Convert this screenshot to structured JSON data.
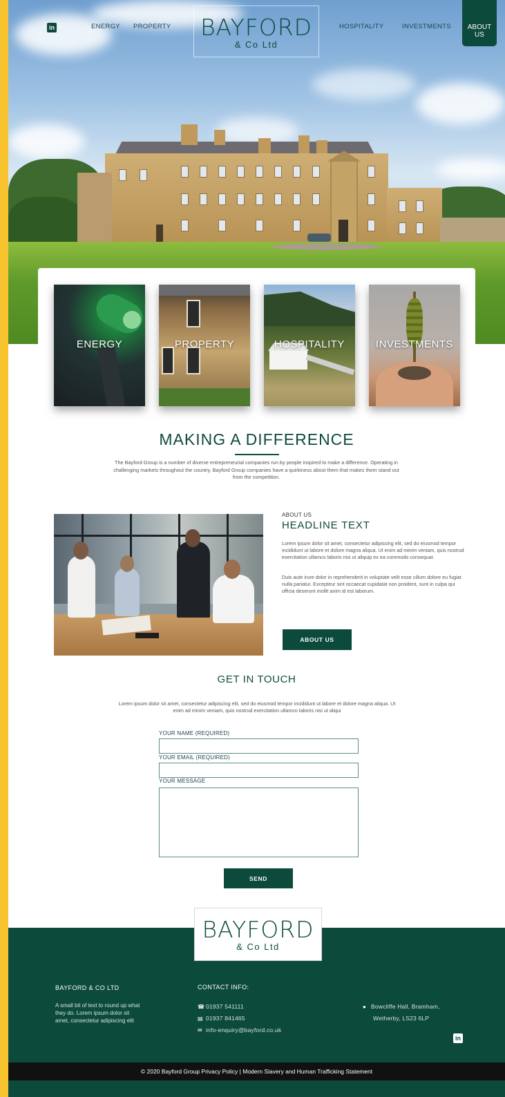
{
  "nav": {
    "linkedin_icon": "linkedin-icon",
    "left_links": [
      "ENERGY",
      "PROPERTY"
    ],
    "right_links": [
      "HOSPITALITY",
      "INVESTMENTS"
    ],
    "about_line1": "ABOUT",
    "about_line2": "US"
  },
  "logo": {
    "main": "BAYFORD",
    "sub": "& Co Ltd"
  },
  "cards": [
    {
      "label": "ENERGY"
    },
    {
      "label": "PROPERTY"
    },
    {
      "label": "HOSPITALITY"
    },
    {
      "label": "INVESTMENTS"
    }
  ],
  "intro": {
    "heading": "MAKING A DIFFERENCE",
    "text": "The Bayford Group is a number of diverse entrepreneurial companies run by people inspired to make a difference. Operating in challenging markets throughout the country, Bayford Group companies have a quirkiness about them that makes them stand out from the competition."
  },
  "about": {
    "eyebrow": "ABOUT US",
    "heading": "HEADLINE TEXT",
    "p1": "Lorem ipsum dolor sit amet, consectetur adipiscing elit, sed do eiusmod tempor incididunt ut labore et dolore magna aliqua. Ut enim ad minim veniam, quis nostrud exercitation ullamco laboris nisi ut aliquip ex ea commodo consequat.",
    "p2": "Duis aute irure dolor in reprehenderit in voluptate velit esse cillum dolore eu fugiat nulla pariatur. Excepteur sint occaecat cupidatat non proident, sunt in culpa qui officia deserunt mollit anim id est laborum.",
    "button": "ABOUT US"
  },
  "contact": {
    "heading": "GET IN TOUCH",
    "text": "Lorem ipsum dolor sit amet, consectetur adipiscing elit, sed do eiusmod tempor incididunt ut labore et dolore magna aliqua. Ut enim ad minim veniam, quis nostrud exercitation ullamco laboris nisi ut aliqui",
    "name_label": "YOUR NAME (REQUIRED)",
    "email_label": "YOUR EMAIL (REQUIRED)",
    "message_label": "YOUR MESSAGE",
    "name_value": "",
    "email_value": "",
    "message_value": "",
    "send": "SEND"
  },
  "footer": {
    "company_heading": "BAYFORD & CO LTD",
    "company_text": "A small bit of text to round up what they do. Lorem ipsum dolor sit amet, consectetur adipiscing elit",
    "contact_heading": "CONTACT INFO:",
    "phone": "01937 541111",
    "fax": "01937 841465",
    "email": "info-enquiry@bayford.co.uk",
    "address_line1": "Bowcliffe Hall, Bramham,",
    "address_line2": "Wetherby, LS23 6LP",
    "copyright": "© 2020 Bayford Group Privacy Policy | Modern Slavery and Human Trafficking Statement"
  },
  "colors": {
    "brand_green": "#0c4a3c",
    "accent_yellow": "#f7c42f"
  }
}
